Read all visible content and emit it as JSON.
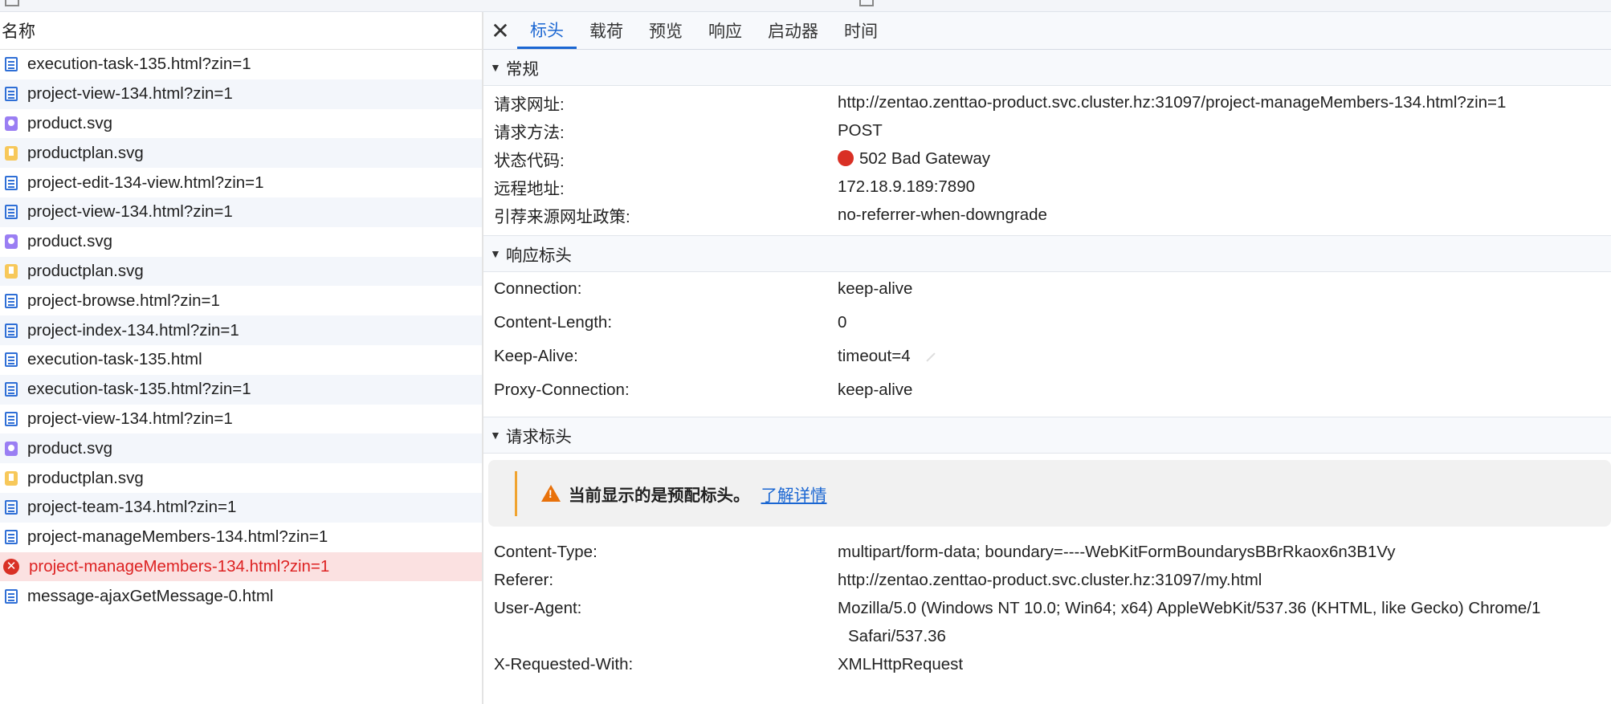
{
  "list": {
    "header": "名称",
    "items": [
      {
        "name": "execution-task-135.html?zin=1",
        "type": "doc",
        "state": "normal"
      },
      {
        "name": "project-view-134.html?zin=1",
        "type": "doc",
        "state": "normal"
      },
      {
        "name": "product.svg",
        "type": "svg",
        "state": "normal"
      },
      {
        "name": "productplan.svg",
        "type": "plan",
        "state": "normal"
      },
      {
        "name": "project-edit-134-view.html?zin=1",
        "type": "doc",
        "state": "normal"
      },
      {
        "name": "project-view-134.html?zin=1",
        "type": "doc",
        "state": "normal"
      },
      {
        "name": "product.svg",
        "type": "svg",
        "state": "normal"
      },
      {
        "name": "productplan.svg",
        "type": "plan",
        "state": "normal"
      },
      {
        "name": "project-browse.html?zin=1",
        "type": "doc",
        "state": "normal"
      },
      {
        "name": "project-index-134.html?zin=1",
        "type": "doc",
        "state": "normal"
      },
      {
        "name": "execution-task-135.html",
        "type": "doc",
        "state": "normal"
      },
      {
        "name": "execution-task-135.html?zin=1",
        "type": "doc",
        "state": "normal"
      },
      {
        "name": "project-view-134.html?zin=1",
        "type": "doc",
        "state": "normal"
      },
      {
        "name": "product.svg",
        "type": "svg",
        "state": "normal"
      },
      {
        "name": "productplan.svg",
        "type": "plan",
        "state": "normal"
      },
      {
        "name": "project-team-134.html?zin=1",
        "type": "doc",
        "state": "normal"
      },
      {
        "name": "project-manageMembers-134.html?zin=1",
        "type": "doc",
        "state": "normal"
      },
      {
        "name": "project-manageMembers-134.html?zin=1",
        "type": "error",
        "state": "error"
      },
      {
        "name": "message-ajaxGetMessage-0.html",
        "type": "doc",
        "state": "normal"
      }
    ]
  },
  "tabs": {
    "close": "✕",
    "items": [
      "标头",
      "载荷",
      "预览",
      "响应",
      "启动器",
      "时间"
    ],
    "active": 0
  },
  "general": {
    "title": "常规",
    "rows": [
      {
        "key": "请求网址:",
        "value": "http://zentao.zenttao-product.svc.cluster.hz:31097/project-manageMembers-134.html?zin=1"
      },
      {
        "key": "请求方法:",
        "value": "POST"
      },
      {
        "key": "状态代码:",
        "value": "502 Bad Gateway"
      },
      {
        "key": "远程地址:",
        "value": "172.18.9.189:7890"
      },
      {
        "key": "引荐来源网址政策:",
        "value": "no-referrer-when-downgrade"
      }
    ]
  },
  "response_headers": {
    "title": "响应标头",
    "rows": [
      {
        "key": "Connection:",
        "value": "keep-alive"
      },
      {
        "key": "Content-Length:",
        "value": "0"
      },
      {
        "key": "Keep-Alive:",
        "value": "timeout=4"
      },
      {
        "key": "Proxy-Connection:",
        "value": "keep-alive"
      }
    ]
  },
  "request_headers": {
    "title": "请求标头",
    "warning": "当前显示的是预配标头。",
    "learn_more": "了解详情",
    "rows": [
      {
        "key": "Content-Type:",
        "value": "multipart/form-data; boundary=----WebKitFormBoundarysBBrRkaox6n3B1Vy"
      },
      {
        "key": "Referer:",
        "value": "http://zentao.zenttao-product.svc.cluster.hz:31097/my.html"
      },
      {
        "key": "User-Agent:",
        "value": "Mozilla/5.0 (Windows NT 10.0; Win64; x64) AppleWebKit/537.36 (KHTML, like Gecko) Chrome/1"
      },
      {
        "key": "X-Requested-With:",
        "value": "XMLHttpRequest"
      }
    ],
    "user_agent_cont": "Safari/537.36"
  },
  "colors": {
    "accent": "#1a66d2",
    "error": "#d93025",
    "error_row_bg": "#fbe1e1",
    "warning_bar": "#f0a32f"
  }
}
